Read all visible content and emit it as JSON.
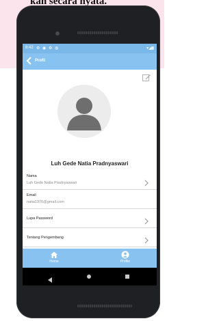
{
  "caption": {
    "text": "kan secara nyata."
  },
  "status_bar": {
    "time": "8:42",
    "icons": "⚙ ◉ ⚙ ◍",
    "right": "▾◢▮"
  },
  "app_bar": {
    "title": "Profil"
  },
  "profile": {
    "name": "Luh Gede Natia Pradnyaswari"
  },
  "rows": [
    {
      "label": "Nama",
      "value": "Luh Gede Natia Pradnyaswari"
    },
    {
      "label": "Email",
      "value": "natia1976@gmail.com"
    },
    {
      "label": "Lupa Password"
    },
    {
      "label": "Tentang Pengembang"
    }
  ],
  "bottom_nav": {
    "items": [
      {
        "label": "Home",
        "icon": "home-icon"
      },
      {
        "label": "Profile",
        "icon": "account-icon",
        "active": true
      }
    ]
  },
  "colors": {
    "accent": "#87c2f0",
    "status": "#7ab8ea",
    "caption_bg": "#fce4ec"
  }
}
